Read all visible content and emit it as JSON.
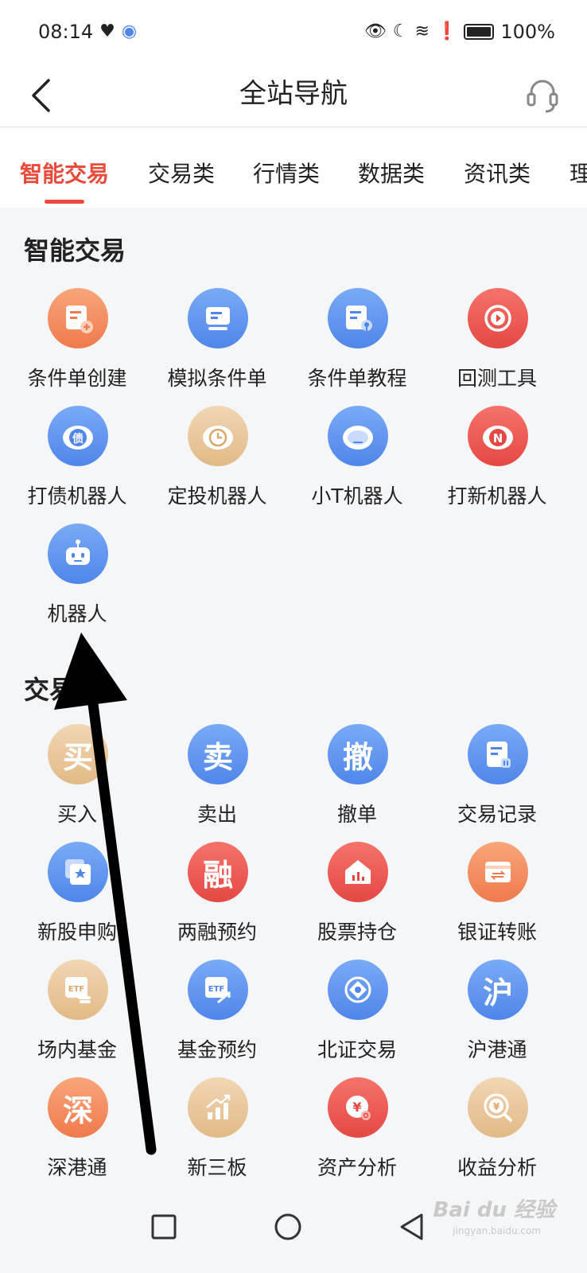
{
  "status_bar": {
    "time": "08:14",
    "battery": "100%"
  },
  "header": {
    "title": "全站导航"
  },
  "tabs": [
    {
      "label": "智能交易",
      "active": true
    },
    {
      "label": "交易类",
      "active": false
    },
    {
      "label": "行情类",
      "active": false
    },
    {
      "label": "数据类",
      "active": false
    },
    {
      "label": "资讯类",
      "active": false
    },
    {
      "label": "理",
      "active": false
    }
  ],
  "sections": [
    {
      "title": "智能交易",
      "items": [
        {
          "label": "条件单创建",
          "icon": "condition-order-create-icon",
          "color": "orange"
        },
        {
          "label": "模拟条件单",
          "icon": "simulated-condition-order-icon",
          "color": "blue"
        },
        {
          "label": "条件单教程",
          "icon": "condition-order-tutorial-icon",
          "color": "blue"
        },
        {
          "label": "回测工具",
          "icon": "backtest-tool-icon",
          "color": "red"
        },
        {
          "label": "打债机器人",
          "icon": "bond-robot-icon",
          "color": "blue"
        },
        {
          "label": "定投机器人",
          "icon": "fixed-investment-robot-icon",
          "color": "beige"
        },
        {
          "label": "小T机器人",
          "icon": "t-robot-icon",
          "color": "blue"
        },
        {
          "label": "打新机器人",
          "icon": "ipo-robot-icon",
          "color": "red"
        },
        {
          "label": "机器人",
          "icon": "robot-icon",
          "color": "blue"
        }
      ]
    },
    {
      "title": "交易",
      "items": [
        {
          "label": "买入",
          "icon": "buy-icon",
          "char": "买",
          "color": "beige"
        },
        {
          "label": "卖出",
          "icon": "sell-icon",
          "char": "卖",
          "color": "blue"
        },
        {
          "label": "撤单",
          "icon": "cancel-order-icon",
          "char": "撤",
          "color": "blue"
        },
        {
          "label": "交易记录",
          "icon": "trade-record-icon",
          "color": "blue"
        },
        {
          "label": "新股申购",
          "icon": "ipo-subscribe-icon",
          "color": "blue"
        },
        {
          "label": "两融预约",
          "icon": "margin-reserve-icon",
          "char": "融",
          "color": "red"
        },
        {
          "label": "股票持仓",
          "icon": "stock-position-icon",
          "color": "red"
        },
        {
          "label": "银证转账",
          "icon": "bank-transfer-icon",
          "color": "orange"
        },
        {
          "label": "场内基金",
          "icon": "etf-fund-icon",
          "color": "beige"
        },
        {
          "label": "基金预约",
          "icon": "fund-reserve-icon",
          "color": "blue"
        },
        {
          "label": "北证交易",
          "icon": "bse-trade-icon",
          "color": "blue"
        },
        {
          "label": "沪港通",
          "icon": "sh-hk-connect-icon",
          "char": "沪",
          "color": "blue"
        },
        {
          "label": "深港通",
          "icon": "sz-hk-connect-icon",
          "char": "深",
          "color": "orange"
        },
        {
          "label": "新三板",
          "icon": "neeq-icon",
          "color": "beige"
        },
        {
          "label": "资产分析",
          "icon": "asset-analysis-icon",
          "color": "red"
        },
        {
          "label": "收益分析",
          "icon": "profit-analysis-icon",
          "color": "beige"
        }
      ]
    }
  ],
  "watermark": {
    "brand": "Bai du 经验",
    "sub": "jingyan.baidu.com"
  }
}
